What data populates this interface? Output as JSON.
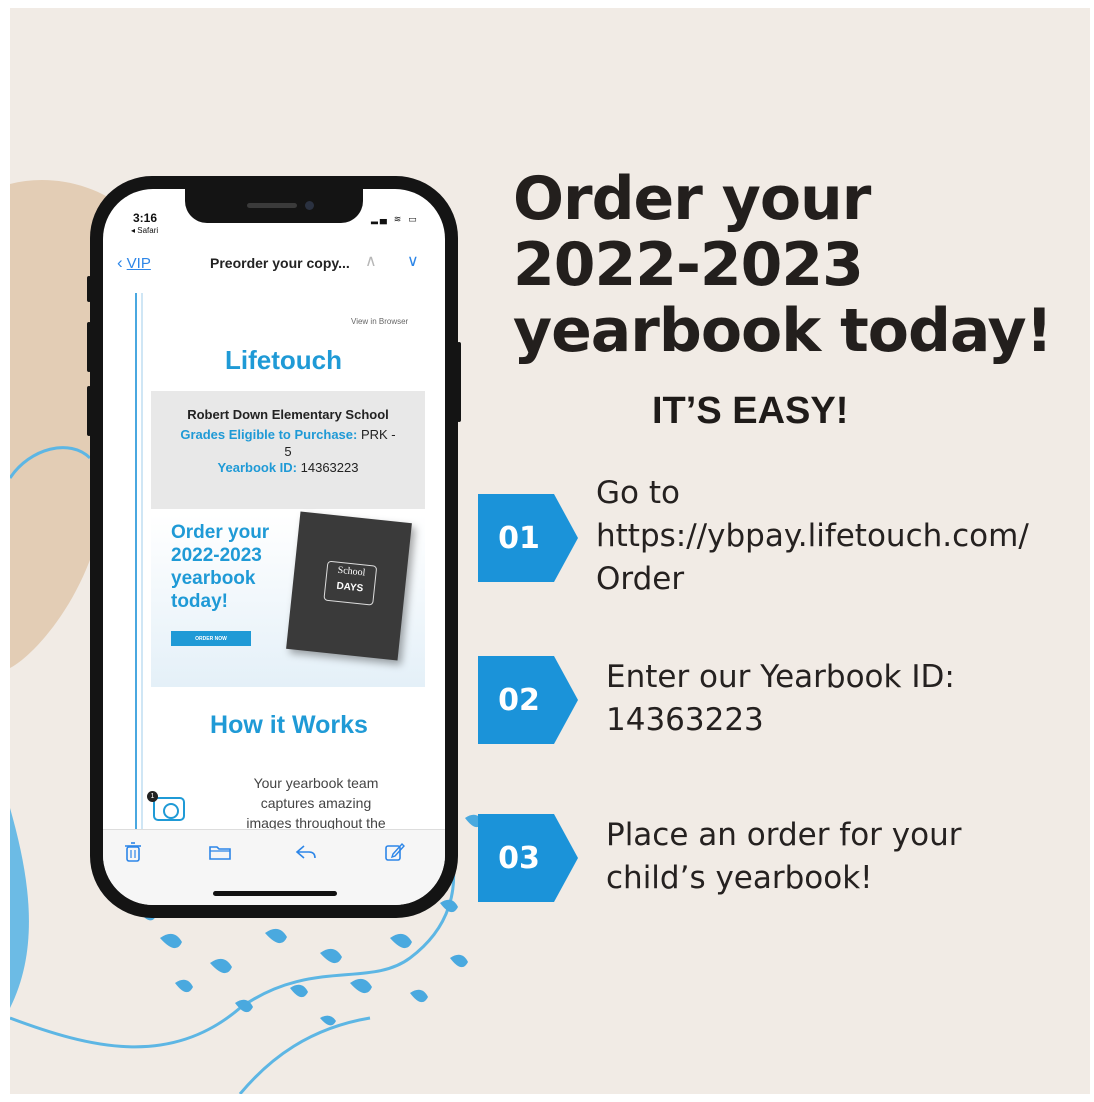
{
  "headline": {
    "lines": [
      "Order your",
      "2022-2023",
      "yearbook today!"
    ]
  },
  "subhead": "IT’S EASY!",
  "steps": [
    {
      "number": "01",
      "lines": [
        "Go to",
        "https://ybpay.lifetouch.com/",
        "Order"
      ]
    },
    {
      "number": "02",
      "lines": [
        "Enter our Yearbook ID:",
        "14363223"
      ]
    },
    {
      "number": "03",
      "lines": [
        "Place an order for your",
        "child’s yearbook!"
      ]
    }
  ],
  "phone": {
    "status": {
      "time": "3:16",
      "back_app": "◂ Safari",
      "icons": "▂▄ ≋ ▭"
    },
    "mail_nav": {
      "back_label": "VIP",
      "subject": "Preorder your copy...",
      "up_icon": "chevron-up-icon",
      "down_icon": "chevron-down-icon"
    },
    "email": {
      "view_in_browser": "View in Browser",
      "brand": "Lifetouch",
      "school_name": "Robert Down Elementary School",
      "grades_label": "Grades Eligible to Purchase:",
      "grades_value": "PRK -",
      "grades_value_cont": "5",
      "yearbook_id_label": "Yearbook ID:",
      "yearbook_id_value": "14363223",
      "promo_title_lines": [
        "Order your",
        "2022-2023",
        "yearbook",
        "today!"
      ],
      "promo_button": "ORDER NOW",
      "book_cover_script": "School",
      "book_cover_title": "DAYS",
      "how_title": "How it Works",
      "how_text_lines": [
        "Your yearbook team",
        "captures amazing",
        "images throughout the"
      ],
      "camera_badge": "1"
    },
    "toolbar": [
      "trash-icon",
      "folder-icon",
      "reply-icon",
      "compose-icon"
    ]
  },
  "colors": {
    "background": "#f1ebe5",
    "accent_blue": "#1b93d9",
    "blob_tan": "#e3cdb5",
    "text_dark": "#231f1d"
  }
}
